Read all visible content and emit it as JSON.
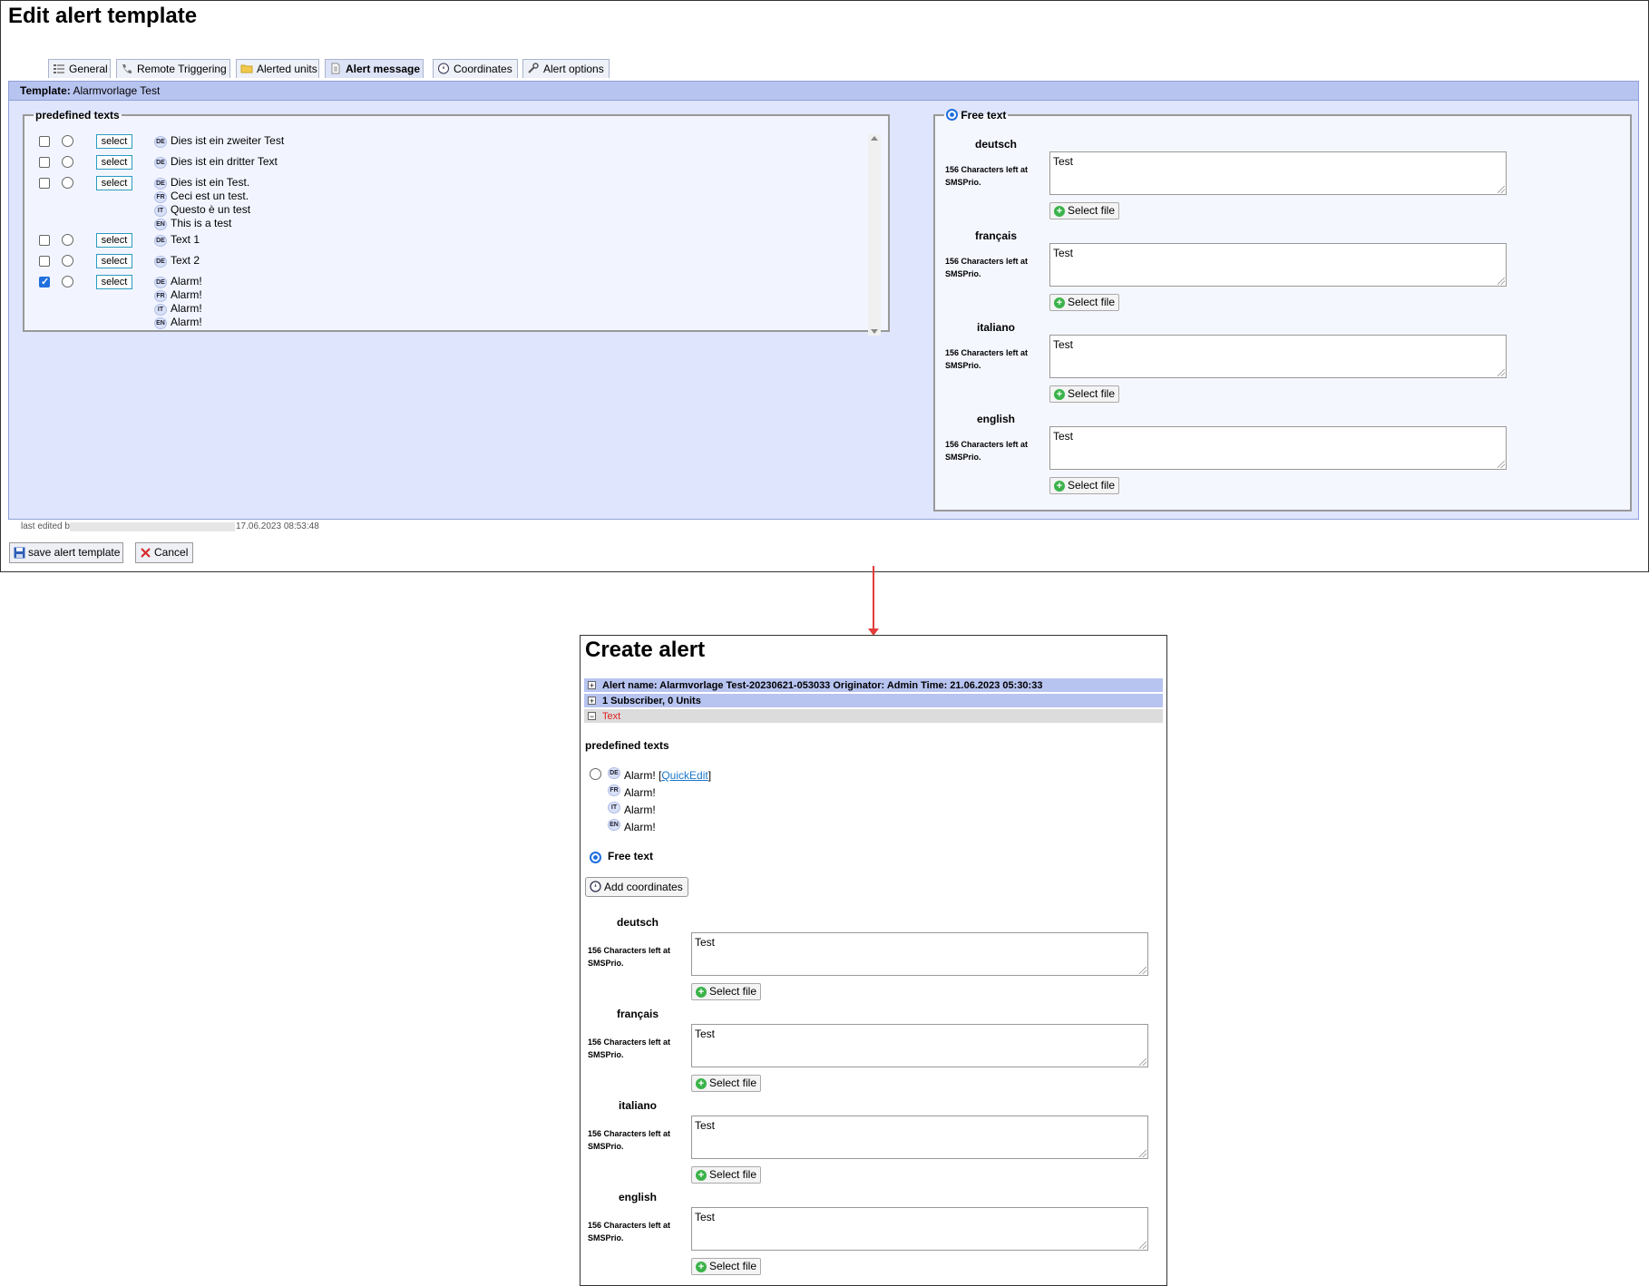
{
  "edit_template": {
    "title": "Edit alert template",
    "tabs": [
      {
        "label": "General",
        "icon": "list-icon"
      },
      {
        "label": "Remote Triggering",
        "icon": "phone-icon"
      },
      {
        "label": "Alerted units",
        "icon": "folder-icon"
      },
      {
        "label": "Alert message",
        "icon": "document-icon",
        "active": true
      },
      {
        "label": "Coordinates",
        "icon": "compass-icon"
      },
      {
        "label": "Alert options",
        "icon": "tools-icon"
      }
    ],
    "template_label": "Template:",
    "template_name": "Alarmvorlage Test",
    "predefined_legend": "predefined texts",
    "select_label": "select",
    "predefined": [
      {
        "checked": false,
        "lines": [
          {
            "lang": "DE",
            "text": "Dies ist ein zweiter Test"
          }
        ]
      },
      {
        "checked": false,
        "lines": [
          {
            "lang": "DE",
            "text": "Dies ist ein dritter Text"
          }
        ]
      },
      {
        "checked": false,
        "lines": [
          {
            "lang": "DE",
            "text": "Dies ist ein Test."
          },
          {
            "lang": "FR",
            "text": "Ceci est un test."
          },
          {
            "lang": "IT",
            "text": "Questo è un test"
          },
          {
            "lang": "EN",
            "text": "This is a test"
          }
        ]
      },
      {
        "checked": false,
        "lines": [
          {
            "lang": "DE",
            "text": "Text 1"
          }
        ]
      },
      {
        "checked": false,
        "lines": [
          {
            "lang": "DE",
            "text": "Text 2"
          }
        ]
      },
      {
        "checked": true,
        "lines": [
          {
            "lang": "DE",
            "text": "Alarm!"
          },
          {
            "lang": "FR",
            "text": "Alarm!"
          },
          {
            "lang": "IT",
            "text": "Alarm!"
          },
          {
            "lang": "EN",
            "text": "Alarm!"
          }
        ]
      }
    ],
    "free_text_label": "Free text",
    "languages": [
      {
        "name": "deutsch",
        "chars_left": "156 Characters left at SMSPrio.",
        "value": "Test",
        "file_button": "Select file"
      },
      {
        "name": "français",
        "chars_left": "156 Characters left at SMSPrio.",
        "value": "Test",
        "file_button": "Select file"
      },
      {
        "name": "italiano",
        "chars_left": "156 Characters left at SMSPrio.",
        "value": "Test",
        "file_button": "Select file"
      },
      {
        "name": "english",
        "chars_left": "156 Characters left at SMSPrio.",
        "value": "Test",
        "file_button": "Select file"
      }
    ],
    "last_edited_label": "last edited by",
    "last_edited_time": "17.06.2023 08:53:48",
    "save_button": "save alert template",
    "cancel_button": "Cancel"
  },
  "create_alert": {
    "title": "Create alert",
    "sections": [
      {
        "toggle": "+",
        "text": "Alert name: Alarmvorlage Test-20230621-053033 Originator: Admin Time: 21.06.2023 05:30:33"
      },
      {
        "toggle": "+",
        "text": "1 Subscriber, 0 Units"
      },
      {
        "toggle": "−",
        "text": "Text"
      }
    ],
    "predefined_heading": "predefined texts",
    "predefined_lines": [
      {
        "lang": "DE",
        "text": "Alarm!"
      },
      {
        "lang": "FR",
        "text": "Alarm!"
      },
      {
        "lang": "IT",
        "text": "Alarm!"
      },
      {
        "lang": "EN",
        "text": "Alarm!"
      }
    ],
    "quickedit_link": "QuickEdit",
    "free_text_label": "Free text",
    "add_coordinates": "Add coordinates",
    "languages": [
      {
        "name": "deutsch",
        "chars_left": "156 Characters left at SMSPrio.",
        "value": "Test",
        "file_button": "Select file"
      },
      {
        "name": "français",
        "chars_left": "156 Characters left at SMSPrio.",
        "value": "Test",
        "file_button": "Select file"
      },
      {
        "name": "italiano",
        "chars_left": "156 Characters left at SMSPrio.",
        "value": "Test",
        "file_button": "Select file"
      },
      {
        "name": "english",
        "chars_left": "156 Characters left at SMSPrio.",
        "value": "Test",
        "file_button": "Select file"
      }
    ]
  },
  "colors": {
    "panel_bg": "#dfe5fc",
    "header_bg": "#b8c4f0",
    "arrow": "#e23b3b",
    "accent": "#1f6fde"
  }
}
